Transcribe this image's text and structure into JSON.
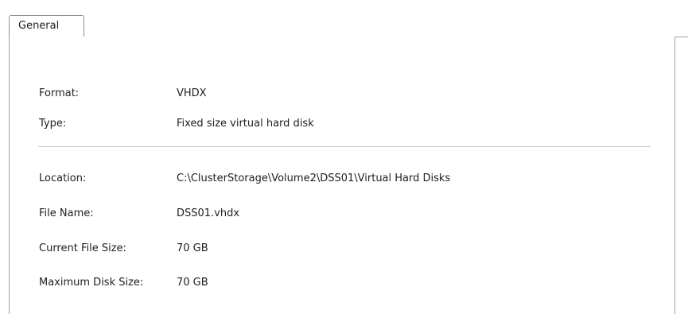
{
  "tabs": [
    {
      "label": "General"
    }
  ],
  "general": {
    "format_label": "Format:",
    "format_value": "VHDX",
    "type_label": "Type:",
    "type_value": "Fixed size virtual hard disk",
    "location_label": "Location:",
    "location_value": "C:\\ClusterStorage\\Volume2\\DSS01\\Virtual Hard Disks",
    "file_name_label": "File Name:",
    "file_name_value": "DSS01.vhdx",
    "current_size_label": "Current File Size:",
    "current_size_value": "70 GB",
    "max_size_label": "Maximum Disk Size:",
    "max_size_value": "70 GB"
  }
}
